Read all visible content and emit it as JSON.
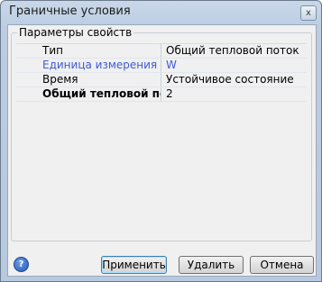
{
  "window": {
    "title": "Граничные условия",
    "close_label": "x"
  },
  "group": {
    "title": "Параметры свойств"
  },
  "properties": [
    {
      "name": "Тип",
      "value": "Общий тепловой поток",
      "style": "normal"
    },
    {
      "name": "Единица измерения",
      "value": "W",
      "style": "link"
    },
    {
      "name": "Время",
      "value": "Устойчивое состояние",
      "style": "normal"
    },
    {
      "name": "Общий тепловой пот...",
      "value": "2",
      "style": "bold"
    }
  ],
  "buttons": {
    "apply": "Применить",
    "delete": "Удалить",
    "cancel": "Отмена"
  },
  "help": {
    "icon": "help-icon",
    "glyph": "?"
  }
}
